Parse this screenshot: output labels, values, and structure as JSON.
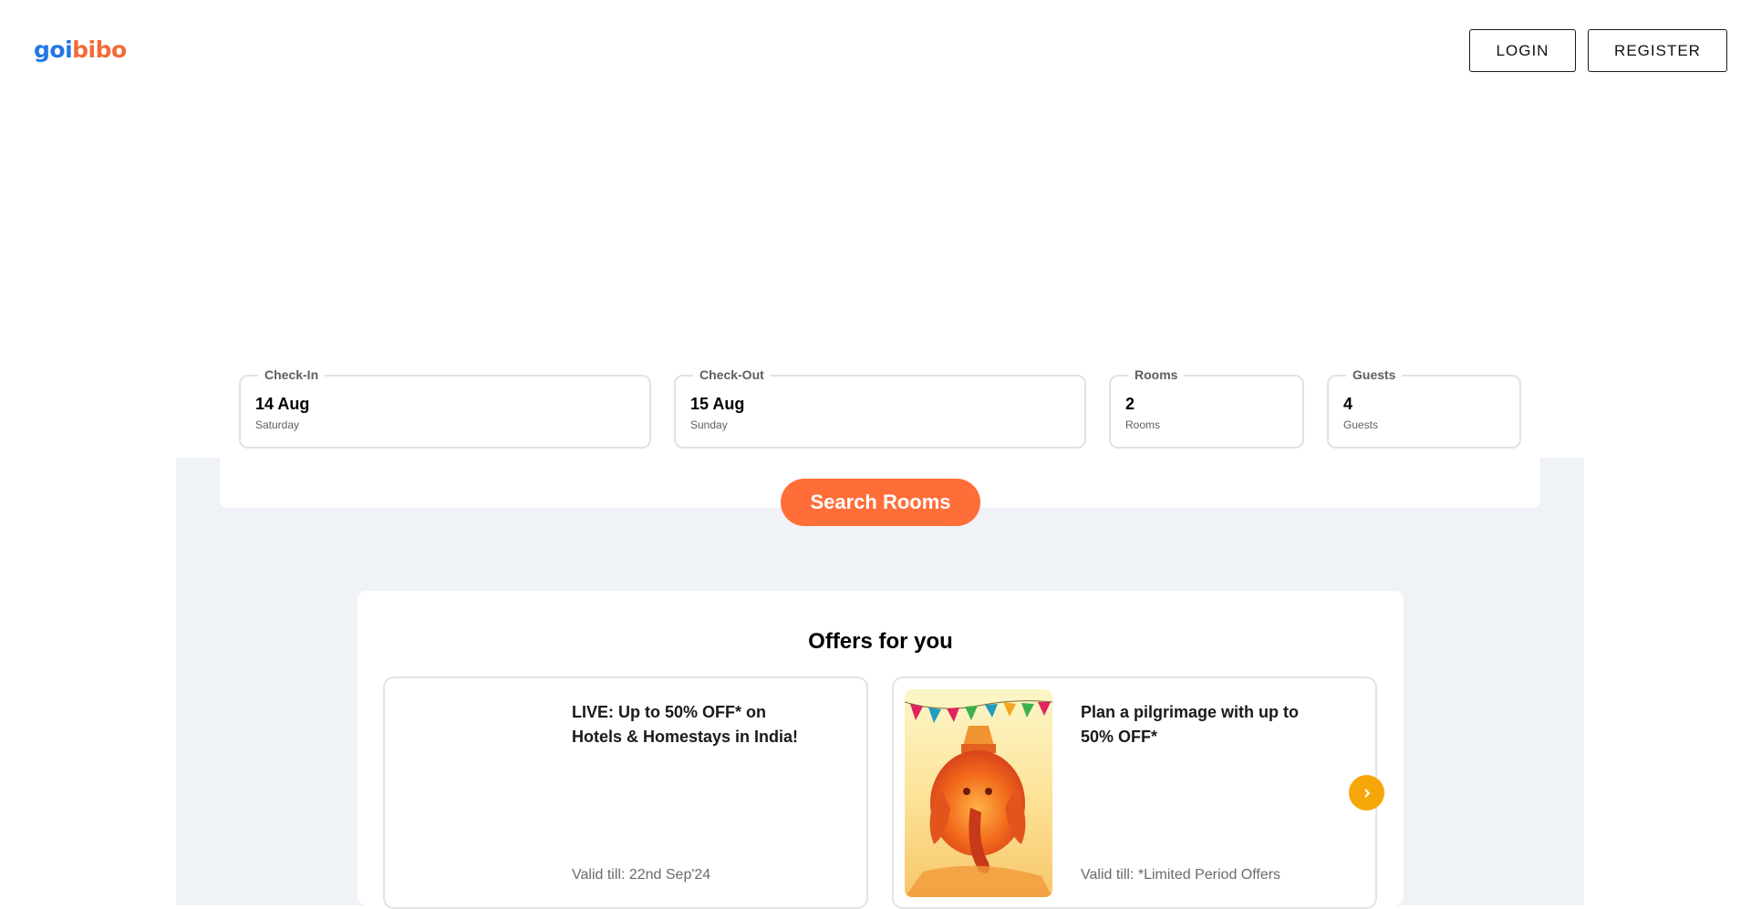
{
  "brand": {
    "logo_part1": "goi",
    "logo_part2": "bibo"
  },
  "header": {
    "login_label": "LOGIN",
    "register_label": "REGISTER"
  },
  "search": {
    "checkin": {
      "label": "Check-In",
      "value": "14 Aug",
      "sub": "Saturday"
    },
    "checkout": {
      "label": "Check-Out",
      "value": "15 Aug",
      "sub": "Sunday"
    },
    "rooms": {
      "label": "Rooms",
      "value": "2",
      "sub": "Rooms"
    },
    "guests": {
      "label": "Guests",
      "value": "4",
      "sub": "Guests"
    },
    "button_label": "Search Rooms"
  },
  "offers": {
    "title": "Offers for you",
    "items": [
      {
        "text": "LIVE: Up to 50% OFF* on Hotels & Homestays in India!",
        "valid": "Valid till: 22nd Sep'24"
      },
      {
        "text": "Plan a pilgrimage with up to 50% OFF*",
        "valid": "Valid till: *Limited Period Offers"
      }
    ],
    "next_icon": "chevron-right-icon"
  },
  "colors": {
    "accent": "#ff6d38",
    "logo_blue": "#2276e3",
    "logo_orange": "#f26b3a",
    "arrow": "#f6a609",
    "band": "#eff2f6"
  }
}
